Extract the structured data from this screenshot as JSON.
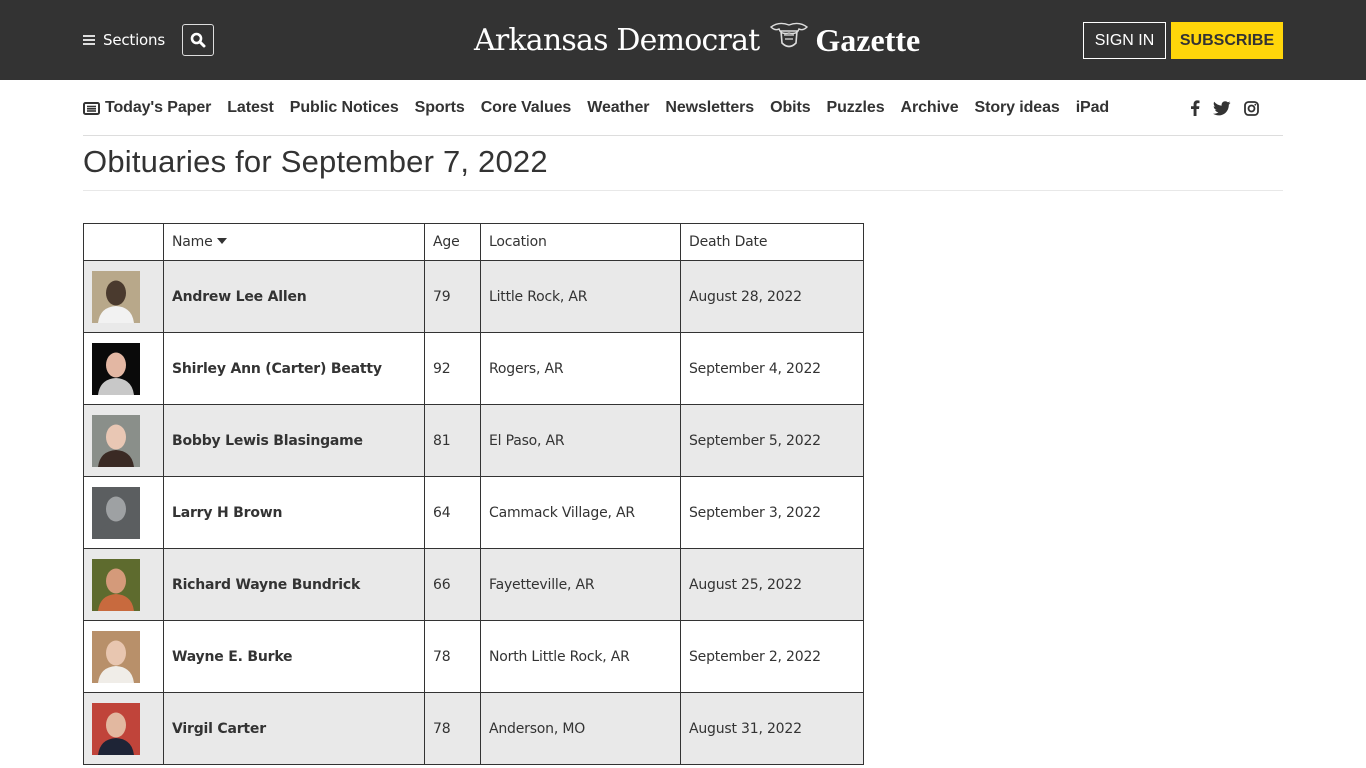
{
  "header": {
    "sections_label": "Sections",
    "logo": {
      "left": "Arkansas Democrat",
      "right": "Gazette"
    },
    "signin_label": "SIGN IN",
    "subscribe_label": "SUBSCRIBE",
    "colors": {
      "bar": "#333333",
      "subscribe": "#ffd60a"
    }
  },
  "nav": {
    "items": [
      {
        "label": "Today's Paper",
        "icon": "newspaper-icon"
      },
      {
        "label": "Latest"
      },
      {
        "label": "Public Notices"
      },
      {
        "label": "Sports"
      },
      {
        "label": "Core Values"
      },
      {
        "label": "Weather"
      },
      {
        "label": "Newsletters"
      },
      {
        "label": "Obits"
      },
      {
        "label": "Puzzles"
      },
      {
        "label": "Archive"
      },
      {
        "label": "Story ideas"
      },
      {
        "label": "iPad"
      }
    ],
    "social": [
      "facebook-icon",
      "twitter-icon",
      "instagram-icon"
    ]
  },
  "page": {
    "title": "Obituaries for September 7, 2022"
  },
  "table": {
    "headers": {
      "photo": "",
      "name": "Name",
      "age": "Age",
      "location": "Location",
      "death_date": "Death Date"
    },
    "sort": {
      "column": "Name",
      "direction": "descending-caret"
    },
    "rows": [
      {
        "name": "Andrew Lee Allen",
        "age": "79",
        "location": "Little Rock, AR",
        "death_date": "August 28, 2022",
        "photo": {
          "bg": "#b8a88a",
          "fg": "#4a3a2e",
          "shirt": "#f2f2f2"
        }
      },
      {
        "name": "Shirley Ann (Carter) Beatty",
        "age": "92",
        "location": "Rogers, AR",
        "death_date": "September 4, 2022",
        "photo": {
          "bg": "#0a0a0a",
          "fg": "#e3b7a3",
          "shirt": "#c8c8c8"
        }
      },
      {
        "name": "Bobby Lewis Blasingame",
        "age": "81",
        "location": "El Paso, AR",
        "death_date": "September 5, 2022",
        "photo": {
          "bg": "#8a8f8a",
          "fg": "#e9c7b4",
          "shirt": "#3a2a24"
        }
      },
      {
        "name": "Larry H Brown",
        "age": "64",
        "location": "Cammack Village, AR",
        "death_date": "September 3, 2022",
        "photo": {
          "bg": "#5b5e60",
          "fg": "#9ea1a3",
          "shirt": "#5b5e60"
        }
      },
      {
        "name": "Richard Wayne Bundrick",
        "age": "66",
        "location": "Fayetteville, AR",
        "death_date": "August 25, 2022",
        "photo": {
          "bg": "#5e6b2e",
          "fg": "#d49a7a",
          "shirt": "#c86a3e"
        }
      },
      {
        "name": "Wayne E. Burke",
        "age": "78",
        "location": "North Little Rock, AR",
        "death_date": "September 2, 2022",
        "photo": {
          "bg": "#b8906a",
          "fg": "#e8c6b0",
          "shirt": "#f0ede8"
        }
      },
      {
        "name": "Virgil Carter",
        "age": "78",
        "location": "Anderson, MO",
        "death_date": "August 31, 2022",
        "photo": {
          "bg": "#c0443a",
          "fg": "#e2b8a0",
          "shirt": "#1e2436"
        }
      }
    ]
  }
}
